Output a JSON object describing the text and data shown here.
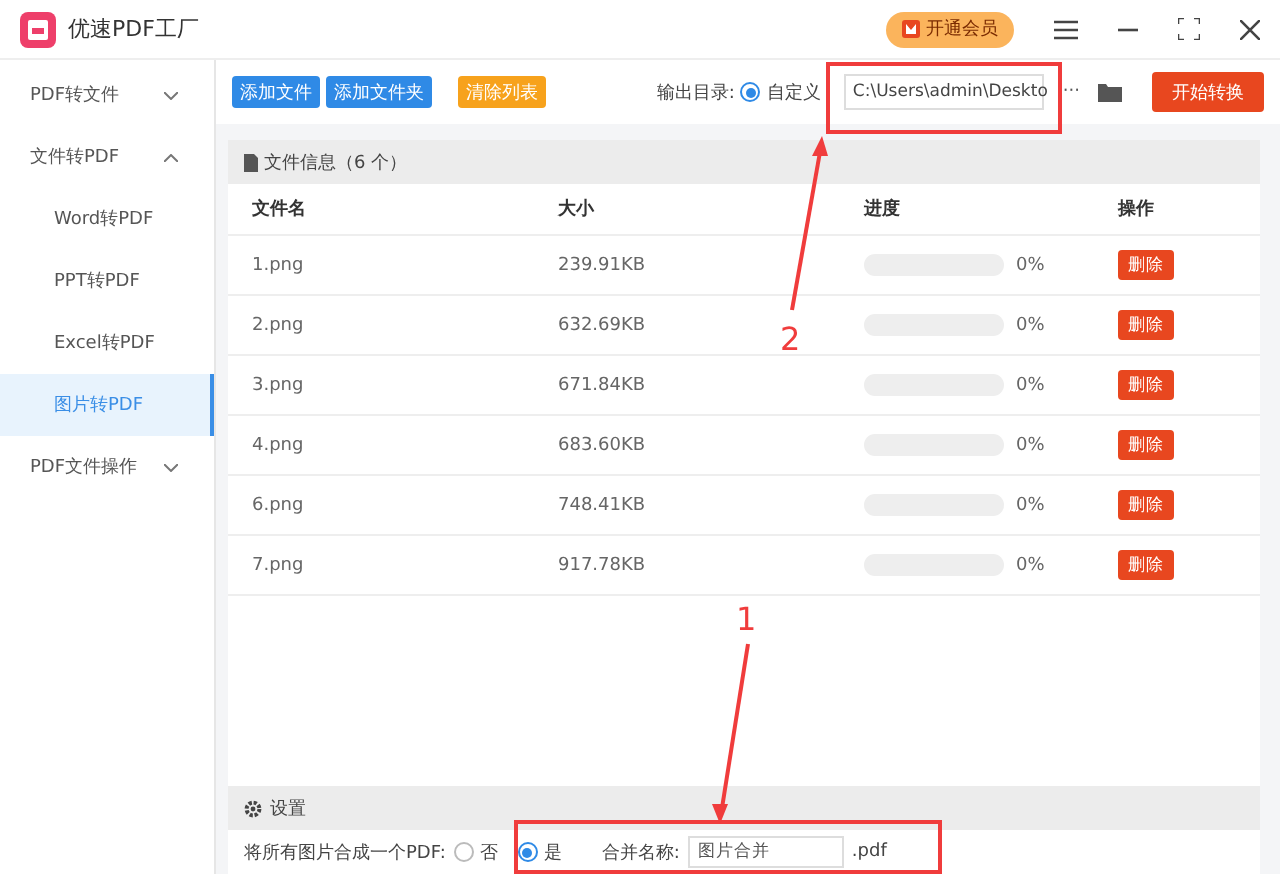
{
  "app": {
    "title": "优速PDF工厂",
    "vip_button": "开通会员"
  },
  "sidebar": [
    {
      "label": "PDF转文件",
      "expanded": false
    },
    {
      "label": "文件转PDF",
      "expanded": true,
      "children": [
        {
          "label": "Word转PDF",
          "selected": false
        },
        {
          "label": "PPT转PDF",
          "selected": false
        },
        {
          "label": "Excel转PDF",
          "selected": false
        },
        {
          "label": "图片转PDF",
          "selected": true
        }
      ]
    },
    {
      "label": "PDF文件操作",
      "expanded": false
    }
  ],
  "toolbar": {
    "buttons": [
      {
        "label": "添加文件",
        "kind": "primary"
      },
      {
        "label": "添加文件夹",
        "kind": "primary"
      },
      {
        "label": "清除列表",
        "kind": "warning"
      }
    ],
    "output_label": "输出目录:",
    "radio_label": "自定义",
    "radio_selected": true,
    "path": "C:\\Users\\admin\\Deskto",
    "more": "···",
    "start": "开始转换"
  },
  "files": {
    "title": "文件信息（6 个）",
    "columns": [
      "文件名",
      "大小",
      "进度",
      "操作"
    ],
    "rows": [
      {
        "name": "1.png",
        "size": "239.91KB",
        "level": 0,
        "percent": "0%",
        "action": "删除"
      },
      {
        "name": "2.png",
        "size": "632.69KB",
        "level": 0,
        "percent": "0%",
        "action": "删除"
      },
      {
        "name": "3.png",
        "size": "671.84KB",
        "level": 0,
        "percent": "0%",
        "action": "删除"
      },
      {
        "name": "4.png",
        "size": "683.60KB",
        "level": 0,
        "percent": "0%",
        "action": "删除"
      },
      {
        "name": "6.png",
        "size": "748.41KB",
        "level": 0,
        "percent": "0%",
        "action": "删除"
      },
      {
        "name": "7.png",
        "size": "917.78KB",
        "level": 0,
        "percent": "0%",
        "action": "删除"
      }
    ]
  },
  "settings": {
    "title": "设置",
    "merge_label": "将所有图片合成一个PDF:",
    "options": [
      {
        "label": "否",
        "selected": false
      },
      {
        "label": "是",
        "selected": true
      }
    ],
    "name_label": "合并名称:",
    "name_value": "图片合并",
    "suffix": ".pdf"
  },
  "annotations": [
    {
      "label": "2"
    },
    {
      "label": "1"
    }
  ]
}
